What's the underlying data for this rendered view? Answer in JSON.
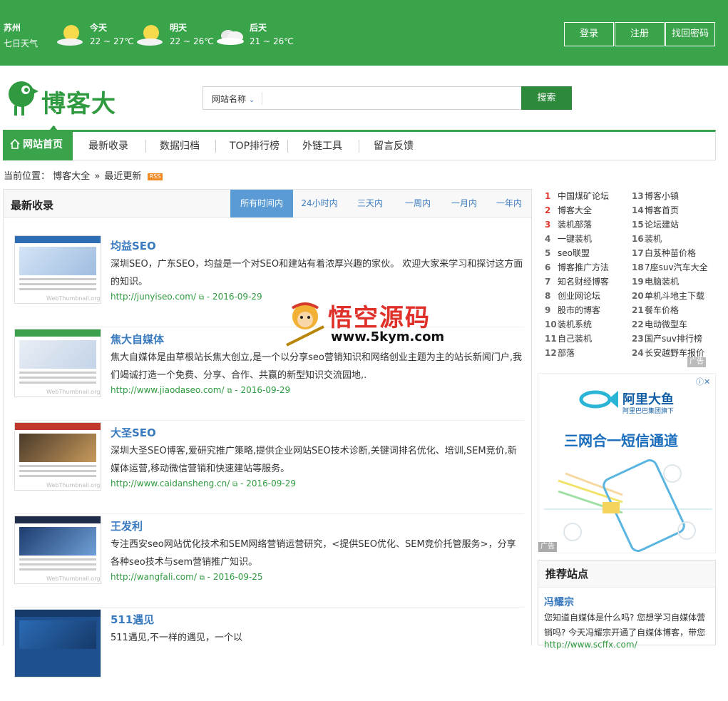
{
  "weather": {
    "city": "苏州",
    "week_label": "七日天气",
    "days": [
      {
        "label": "今天",
        "temp": "22 ~ 27℃",
        "icon": "sunny-cloud-icon"
      },
      {
        "label": "明天",
        "temp": "22 ~ 26℃",
        "icon": "sunny-cloud-icon"
      },
      {
        "label": "后天",
        "temp": "21 ~ 26℃",
        "icon": "cloudy-icon"
      }
    ]
  },
  "account": {
    "login": "登录",
    "register": "注册",
    "recover": "找回密码"
  },
  "logo": {
    "text": "博客大全"
  },
  "search": {
    "select_label": "网站名称",
    "button": "搜索"
  },
  "nav": {
    "home": "网站首页",
    "items": [
      "最新收录",
      "数据归档",
      "TOP排行榜",
      "外链工具",
      "留言反馈"
    ]
  },
  "breadcrumb": {
    "prefix": "当前位置：",
    "root": "博客大全",
    "sep": "»",
    "current": "最近更新",
    "rss": "RSS"
  },
  "main": {
    "title": "最新收录",
    "tabs": [
      "所有时间内",
      "24小时内",
      "三天内",
      "一周内",
      "一月内",
      "一年内"
    ],
    "entries": [
      {
        "title": "均益SEO",
        "desc": "深圳SEO，广东SEO，均益是一个对SEO和建站有着浓厚兴趣的家伙。 欢迎大家来学习和探讨这方面的知识。",
        "url": "http://junyiseo.com/",
        "date": " - 2016-09-29"
      },
      {
        "title": "焦大自媒体",
        "desc": "焦大自媒体是由草根站长焦大创立,是一个以分享seo营销知识和网络创业主题为主的站长新闻门户,我们竭诚打造一个免费、分享、合作、共赢的新型知识交流园地,.",
        "url": "http://www.jiaodaseo.com/",
        "date": " - 2016-09-29"
      },
      {
        "title": "大圣SEO",
        "desc": "深圳大圣SEO博客,爱研究推广策略,提供企业网站SEO技术诊断,关键词排名优化、培训,SEM竞价,新媒体运营,移动微信营销和快速建站等服务。",
        "url": "http://www.caidansheng.cn/",
        "date": " - 2016-09-29"
      },
      {
        "title": "王发利",
        "desc": "专注西安seo网站优化技术和SEM网络营销运营研究，<提供SEO优化、SEM竞价托管服务>，分享各种seo技术与sem营销推广知识。",
        "url": "http://wangfali.com/",
        "date": " - 2016-09-25"
      },
      {
        "title": "511遇见",
        "desc": "511遇见,不一样的遇见，一个以",
        "url": "",
        "date": ""
      }
    ],
    "thumb_watermark": "WebThumbnail.org"
  },
  "ranking": {
    "left": [
      {
        "n": "1",
        "t": "中国煤矿论坛"
      },
      {
        "n": "2",
        "t": "博客大全"
      },
      {
        "n": "3",
        "t": "装机部落"
      },
      {
        "n": "4",
        "t": "一键装机"
      },
      {
        "n": "5",
        "t": "seo联盟"
      },
      {
        "n": "6",
        "t": "博客推广方法"
      },
      {
        "n": "7",
        "t": "知名财经博客"
      },
      {
        "n": "8",
        "t": "创业网论坛"
      },
      {
        "n": "9",
        "t": "股市的博客"
      },
      {
        "n": "10",
        "t": "装机系统"
      },
      {
        "n": "11",
        "t": "自己装机"
      },
      {
        "n": "12",
        "t": "部落"
      }
    ],
    "right": [
      {
        "n": "13",
        "t": "博客小镇"
      },
      {
        "n": "14",
        "t": "博客首页"
      },
      {
        "n": "15",
        "t": "论坛建站"
      },
      {
        "n": "16",
        "t": "装机"
      },
      {
        "n": "17",
        "t": "白芨种苗价格"
      },
      {
        "n": "18",
        "t": "7座suv汽车大全"
      },
      {
        "n": "19",
        "t": "电脑装机"
      },
      {
        "n": "20",
        "t": "单机斗地主下载"
      },
      {
        "n": "21",
        "t": "餐车价格"
      },
      {
        "n": "22",
        "t": "电动微型车"
      },
      {
        "n": "23",
        "t": "国产suv排行榜"
      },
      {
        "n": "24",
        "t": "长安越野车报价"
      }
    ],
    "ad_label": "广告"
  },
  "ad": {
    "brand": "阿里大鱼",
    "brand_sub": "阿里巴巴集团旗下",
    "slogan": "三网合一短信通道",
    "label": "广告"
  },
  "recommend": {
    "title": "推荐站点",
    "site_title": "冯耀宗",
    "site_desc": "您知道自媒体是什么吗? 您想学习自媒体营销吗? 今天冯耀宗开通了自媒体博客，带您",
    "site_url": "http://www.scffx.com/"
  },
  "watermark": {
    "cn": "悟空源码",
    "url": "www.5kym.com"
  },
  "colors": {
    "header_green": "#3aa44b",
    "link_blue": "#3a7bbf",
    "url_green": "#2f9a3f",
    "tab_active": "#5b9bd5"
  }
}
